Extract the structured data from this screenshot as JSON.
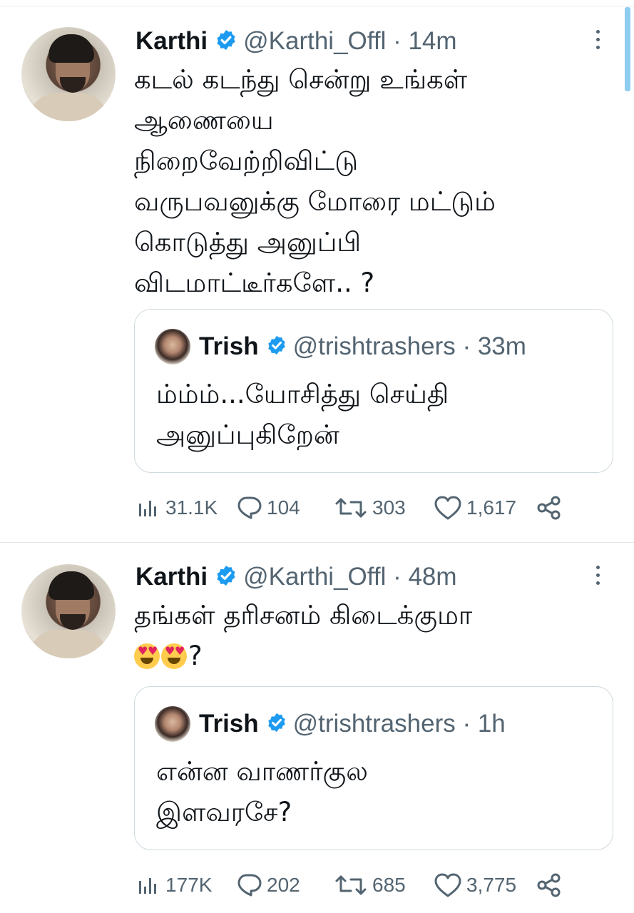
{
  "colors": {
    "accent": "#1d9bf0",
    "text": "#0f1419",
    "secondary": "#536471",
    "border": "#cfd9de"
  },
  "tweets": [
    {
      "name": "Karthi",
      "handle": "@Karthi_Offl · 14m",
      "text": "கடல் கடந்து சென்று உங்கள் ஆணையை நிறைவேற்றிவிட்டு வருபவனுக்கு மோரை மட்டும் கொடுத்து அனுப்பி விடமாட்டீர்களே.. ?",
      "lines": [
        "கடல் கடந்து சென்று உங்கள்",
        "ஆணையை",
        "நிறைவேற்றிவிட்டு",
        "வருபவனுக்கு மோரை மட்டும்",
        "கொடுத்து அனுப்பி",
        "விடமாட்டீர்களே.. ?"
      ],
      "quote": {
        "name": "Trish",
        "handle": "@trishtrashers · 33m",
        "lines": [
          "ம்ம்ம்...யோசித்து செய்தி",
          "அனுப்புகிறேன்"
        ]
      },
      "stats": {
        "views": "31.1K",
        "replies": "104",
        "retweets": "303",
        "likes": "1,617"
      }
    },
    {
      "name": "Karthi",
      "handle": "@Karthi_Offl · 48m",
      "lines": [
        "தங்கள் தரிசனம்  கிடைக்குமா"
      ],
      "emoji_tail": "?",
      "quote": {
        "name": "Trish",
        "handle": "@trishtrashers · 1h",
        "lines": [
          "என்ன வாணர்குல",
          "இளவரசே?"
        ]
      },
      "stats": {
        "views": "177K",
        "replies": "202",
        "retweets": "685",
        "likes": "3,775"
      }
    }
  ]
}
